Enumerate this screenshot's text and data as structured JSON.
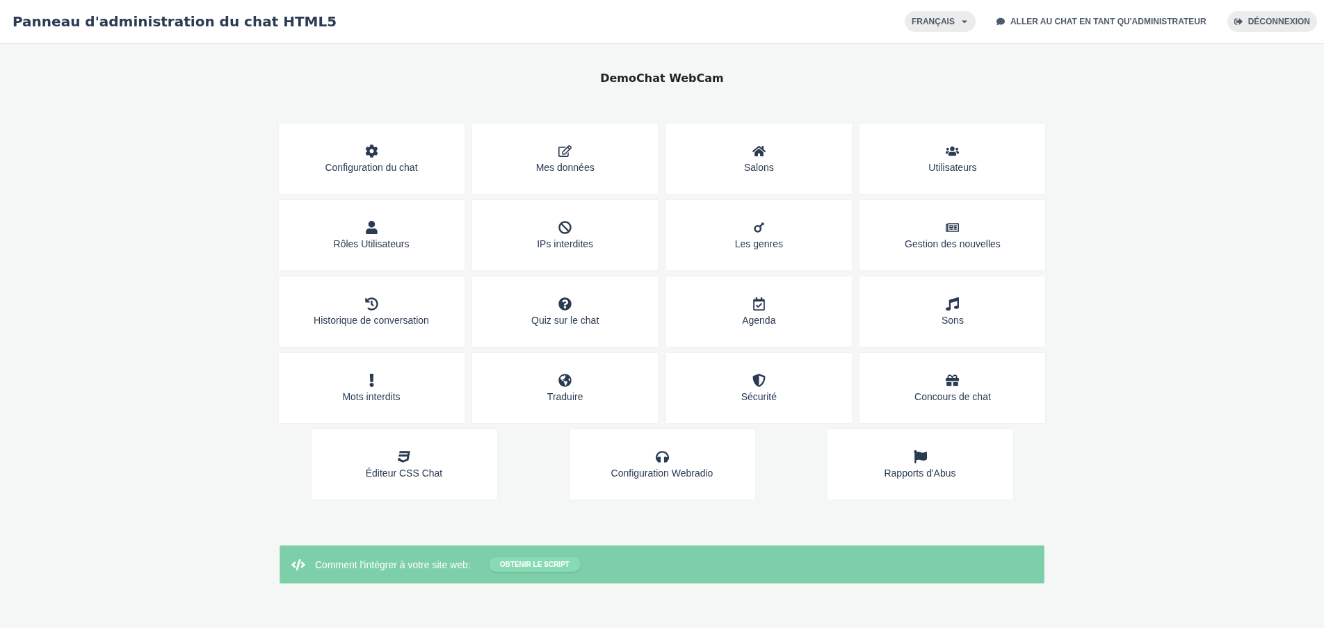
{
  "header": {
    "title": "Panneau d'administration du chat HTML5",
    "language": "FRANÇAIS",
    "go_to_chat": "ALLER AU CHAT EN TANT QU'ADMINISTRATEUR",
    "logout": "DÉCONNEXION"
  },
  "chat_name": "DemoChat WebCam",
  "tiles": [
    {
      "label": "Configuration du chat"
    },
    {
      "label": "Mes données"
    },
    {
      "label": "Salons"
    },
    {
      "label": "Utilisateurs"
    },
    {
      "label": "Rôles Utilisateurs"
    },
    {
      "label": "IPs interdites"
    },
    {
      "label": "Les genres"
    },
    {
      "label": "Gestion des nouvelles"
    },
    {
      "label": "Historique de conversation"
    },
    {
      "label": "Quiz sur le chat"
    },
    {
      "label": "Agenda"
    },
    {
      "label": "Sons"
    },
    {
      "label": "Mots interdits"
    },
    {
      "label": "Traduire"
    },
    {
      "label": "Sécurité"
    },
    {
      "label": "Concours de chat"
    }
  ],
  "extra_tiles": [
    {
      "label": "Éditeur CSS Chat"
    },
    {
      "label": "Configuration Webradio"
    },
    {
      "label": "Rapports d'Abus"
    }
  ],
  "embed_bar": {
    "text": "Comment l'intégrer à votre site web:",
    "button": "OBTENIR LE SCRIPT"
  }
}
